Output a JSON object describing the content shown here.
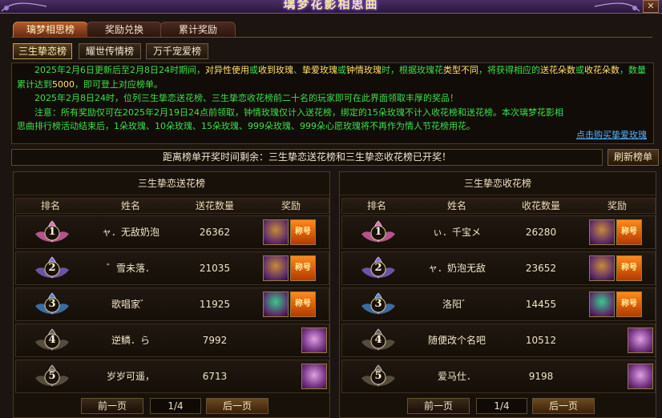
{
  "window": {
    "title": "璃梦花影相思曲"
  },
  "tabs": [
    {
      "label": "璃梦相思榜",
      "active": true
    },
    {
      "label": "奖励兑换",
      "active": false
    },
    {
      "label": "累计奖励",
      "active": false
    }
  ],
  "subtabs": [
    {
      "label": "三生挚恋榜",
      "active": true
    },
    {
      "label": "耀世传情榜",
      "active": false
    },
    {
      "label": "万千宠爱榜",
      "active": false
    }
  ],
  "notice": {
    "p1": [
      "2025年2月6日更新后至2月8日24时期间，",
      "对异性使用",
      "或",
      "收到玫瑰",
      "、",
      "挚爱玫瑰",
      "或",
      "钟情玫瑰",
      "时，根据玫瑰花",
      "类型不同",
      "，将获得相应的",
      "送花朵数",
      "或",
      "收花朵数",
      "，数量累计达到",
      "5000",
      "，即可登上对应榜单。"
    ],
    "p2": "2025年2月8日24时，位列三生挚恋送花榜、三生挚恋收花榜前二十名的玩家即可在此界面领取丰厚的奖品！",
    "p3": "注意：所有奖励仅可在2025年2月19日24点前领取，钟情玫瑰仅计入送花榜，绑定的15朵玫瑰不计入收花榜和送花榜。本次璃梦花影相思曲排行榜活动结束后，1朵玫瑰、10朵玫瑰、15朵玫瑰、999朵玫瑰、999朵心愿玫瑰将不再作为情人节花榜用花。",
    "buy_link": "点击购买挚爱玫瑰"
  },
  "countdown": "距离榜单开奖时间剩余：三生挚恋送花榜和三生挚恋收花榜已开奖！",
  "refresh_label": "刷新榜单",
  "columns": {
    "rank": "排名",
    "name": "姓名",
    "reward": "奖励"
  },
  "left_panel": {
    "title": "三生挚恋送花榜",
    "count_header": "送花数量",
    "rows": [
      {
        "rank": "1",
        "name": "ャ．无敌奶泡",
        "count": "26362",
        "rewards": [
          "chest",
          "title"
        ]
      },
      {
        "rank": "2",
        "name": "゛雪未落．",
        "count": "21035",
        "rewards": [
          "chest",
          "title"
        ]
      },
      {
        "rank": "3",
        "name": "歌唱家゛",
        "count": "11925",
        "rewards": [
          "chest2",
          "title"
        ]
      },
      {
        "rank": "4",
        "name": "逆鳞．ら",
        "count": "7992",
        "rewards": [
          "chestp"
        ]
      },
      {
        "rank": "5",
        "name": "岁岁可遥，",
        "count": "6713",
        "rewards": [
          "chestp"
        ]
      }
    ],
    "pager": {
      "prev": "前一页",
      "page": "1/4",
      "next": "后一页"
    }
  },
  "right_panel": {
    "title": "三生挚恋收花榜",
    "count_header": "收花数量",
    "rows": [
      {
        "rank": "1",
        "name": "ぃ．千宝メ",
        "count": "26280",
        "rewards": [
          "chest",
          "title"
        ]
      },
      {
        "rank": "2",
        "name": "ャ．奶泡无敌",
        "count": "23652",
        "rewards": [
          "chest",
          "title"
        ]
      },
      {
        "rank": "3",
        "name": "洛阳゛",
        "count": "14455",
        "rewards": [
          "chest2",
          "title"
        ]
      },
      {
        "rank": "4",
        "name": "随便改个名吧",
        "count": "10512",
        "rewards": [
          "chestp"
        ]
      },
      {
        "rank": "5",
        "name": "爱马仕．",
        "count": "9198",
        "rewards": [
          "chestp"
        ]
      }
    ],
    "pager": {
      "prev": "前一页",
      "page": "1/4",
      "next": "后一页"
    }
  },
  "title_item_text": "称号",
  "rank_colors": [
    "#e86ab8",
    "#8a6ad8",
    "#4a8ad0",
    "#6a6050",
    "#6a6050"
  ]
}
